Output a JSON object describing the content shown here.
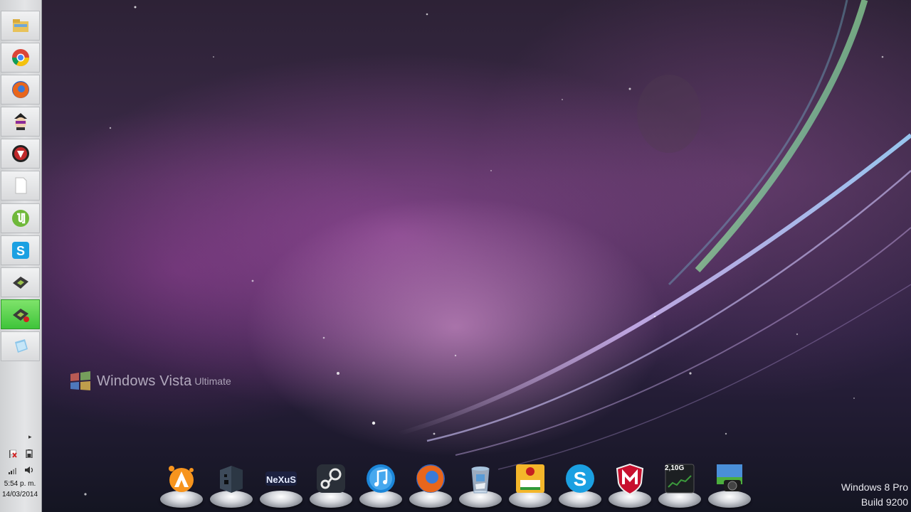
{
  "desktop": {
    "wallpaper": "aurora-purple",
    "vista_logo": {
      "name": "Windows Vista",
      "edition": "Ultimate"
    },
    "watermark": {
      "line1": "Windows 8 Pro",
      "line2": "Build 9200"
    }
  },
  "taskbar": {
    "items": [
      {
        "icon": "file-explorer-icon",
        "active": false
      },
      {
        "icon": "chrome-icon",
        "active": false
      },
      {
        "icon": "firefox-icon",
        "active": false
      },
      {
        "icon": "avatar-character-icon",
        "active": false
      },
      {
        "icon": "red-circle-app-icon",
        "active": false
      },
      {
        "icon": "blank-document-icon",
        "active": false
      },
      {
        "icon": "utorrent-icon",
        "active": false
      },
      {
        "icon": "skype-icon",
        "active": false
      },
      {
        "icon": "chip-app-icon",
        "active": false
      },
      {
        "icon": "chip-app-record-icon",
        "active": true
      },
      {
        "icon": "blue-cube-icon",
        "active": false
      }
    ],
    "tray": {
      "icons": [
        "flag-alert-icon",
        "battery-icon",
        "signal-icon",
        "volume-icon"
      ],
      "time": "5:54 p. m.",
      "date": "14/03/2014"
    }
  },
  "dock": {
    "items": [
      {
        "icon": "avast-icon"
      },
      {
        "icon": "minecraft-icon"
      },
      {
        "icon": "nexus-icon",
        "label": "NeXuS"
      },
      {
        "icon": "steam-icon"
      },
      {
        "icon": "itunes-icon"
      },
      {
        "icon": "firefox-icon"
      },
      {
        "icon": "recycle-bin-icon"
      },
      {
        "icon": "game-cake-icon"
      },
      {
        "icon": "skype-icon"
      },
      {
        "icon": "mcafee-icon"
      },
      {
        "icon": "memory-monitor-icon",
        "label": "2,10G"
      },
      {
        "icon": "camera-photo-icon"
      }
    ]
  }
}
